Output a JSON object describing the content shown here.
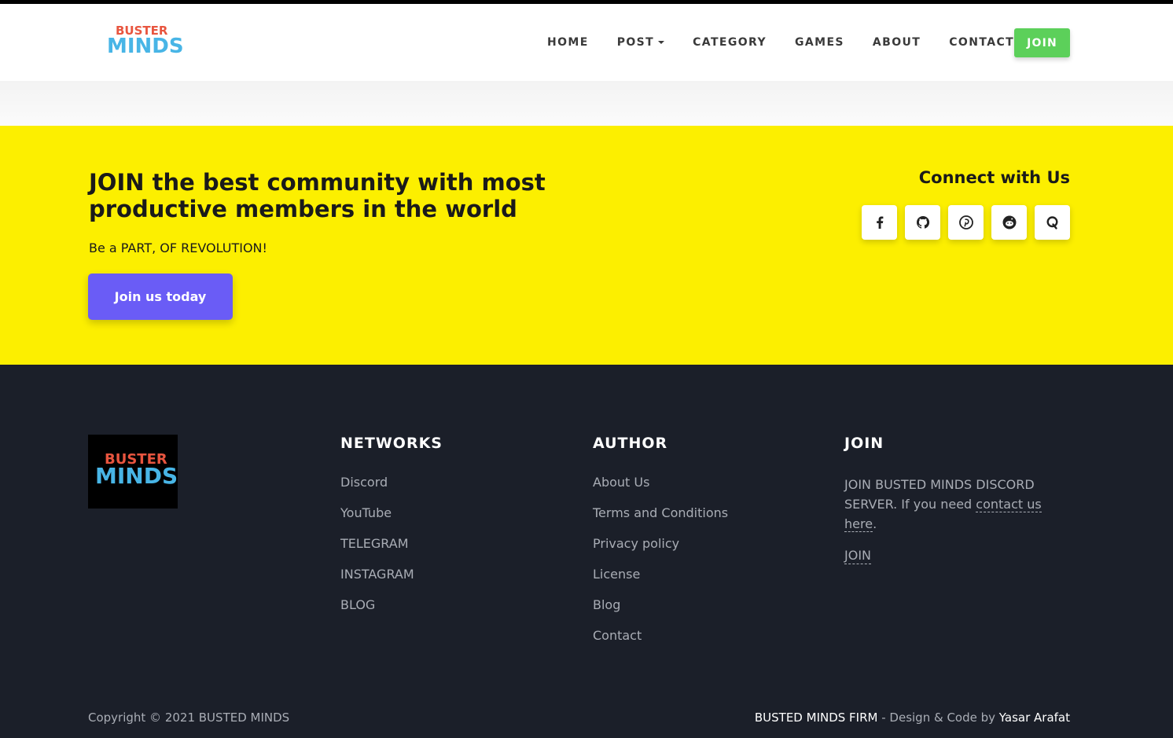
{
  "header": {
    "logo": {
      "line1": "BUSTER",
      "line2": "MINDS"
    },
    "nav": [
      "HOME",
      "POST",
      "CATEGORY",
      "GAMES",
      "ABOUT",
      "CONTACT"
    ],
    "join_label": "JOIN"
  },
  "cta": {
    "title": "JOIN the best community with most productive members in the world",
    "subtitle": "Be a PART, OF REVOLUTION!",
    "button": "Join us today",
    "connect_title": "Connect with Us",
    "socials": [
      "facebook-icon",
      "github-icon",
      "pinterest-icon",
      "reddit-icon",
      "quora-icon"
    ]
  },
  "footer": {
    "logo": {
      "line1": "BUSTER",
      "line2": "MINDS"
    },
    "networks": {
      "title": "NETWORKS",
      "items": [
        "Discord",
        "YouTube",
        "TELEGRAM",
        "INSTAGRAM",
        "BLOG"
      ]
    },
    "author": {
      "title": "AUTHOR",
      "items": [
        "About Us",
        "Terms and Conditions",
        "Privacy policy",
        "License",
        "Blog",
        "Contact"
      ]
    },
    "join": {
      "title": "JOIN",
      "text_before": "JOIN BUSTED MINDS DISCORD SERVER. If you need ",
      "link1": "contact us",
      "link2": "here",
      "text_after": ".",
      "join_link": "JOIN"
    },
    "copyright": "Copyright © 2021 BUSTED MINDS",
    "credits": {
      "firm": "BUSTED MINDS FIRM",
      "middle": " - Design & Code by ",
      "author": "Yasar Arafat"
    }
  },
  "colors": {
    "accent_yellow": "#fcef00",
    "join_green": "#5cd05a",
    "cta_purple": "#6a5cf6",
    "footer_bg": "#1b1f29"
  }
}
